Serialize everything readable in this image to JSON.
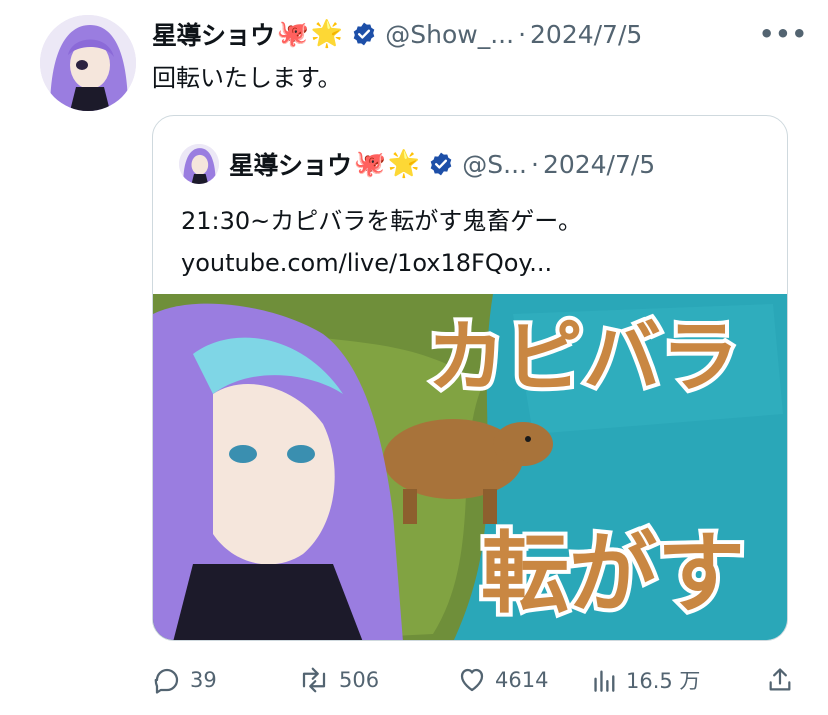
{
  "tweet": {
    "author_name": "星導ショウ",
    "emojis": [
      "🐙",
      "🌟"
    ],
    "handle": "@Show_...",
    "separator": "·",
    "date": "2024/7/5",
    "more": "•••",
    "text": "回転いたします。"
  },
  "quoted": {
    "author_name": "星導ショウ",
    "emojis": [
      "🐙",
      "🌟"
    ],
    "handle": "@S...",
    "separator": "·",
    "date": "2024/7/5",
    "text_line1": "21:30~カピバラを転がす鬼畜ゲー。",
    "text_line2": "youtube.com/live/1ox18FQoy...",
    "thumbnail": {
      "title_top": "カピバラ",
      "title_bottom": "転がす"
    }
  },
  "actions": {
    "replies": "39",
    "reposts": "506",
    "likes": "4614",
    "views": "16.5 万"
  },
  "colors": {
    "text": "#0f1419",
    "muted": "#536471",
    "verified": "#1d4fa8",
    "border": "#cfd9de",
    "hair": "#9a7de0",
    "thumb_ocean": "#2aa7b8",
    "thumb_title": "#c98742"
  },
  "icons": [
    "reply-icon",
    "repost-icon",
    "like-icon",
    "views-icon",
    "share-icon",
    "verified-badge-icon",
    "more-icon"
  ]
}
